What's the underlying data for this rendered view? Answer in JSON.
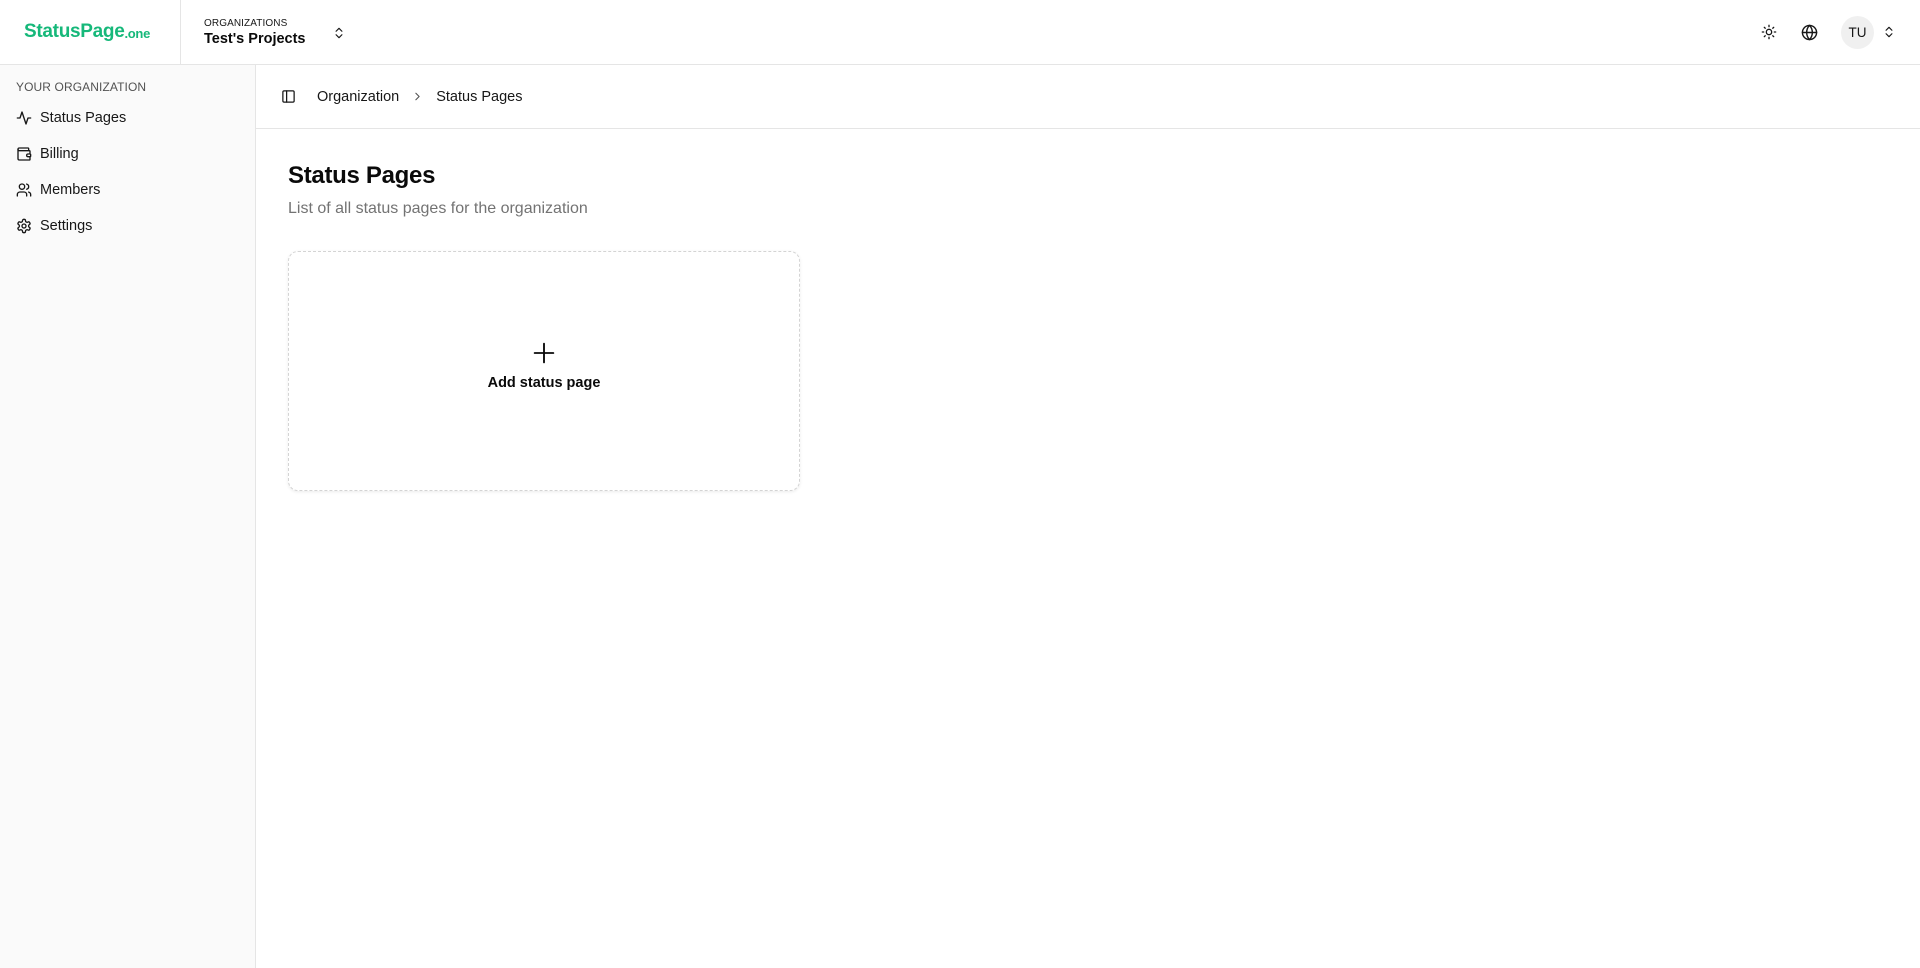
{
  "brand": {
    "name": "StatusPage",
    "suffix": ".one",
    "color": "#16b87a"
  },
  "org_switcher": {
    "kicker": "ORGANIZATIONS",
    "name": "Test's Projects"
  },
  "header": {
    "user_initials": "TU"
  },
  "sidebar": {
    "heading": "YOUR ORGANIZATION",
    "items": [
      {
        "label": "Status Pages",
        "icon": "activity-icon"
      },
      {
        "label": "Billing",
        "icon": "wallet-icon"
      },
      {
        "label": "Members",
        "icon": "users-icon"
      },
      {
        "label": "Settings",
        "icon": "gear-icon"
      }
    ]
  },
  "breadcrumb": {
    "items": [
      "Organization",
      "Status Pages"
    ]
  },
  "page": {
    "title": "Status Pages",
    "subtitle": "List of all status pages for the organization",
    "add_card_label": "Add status page"
  }
}
